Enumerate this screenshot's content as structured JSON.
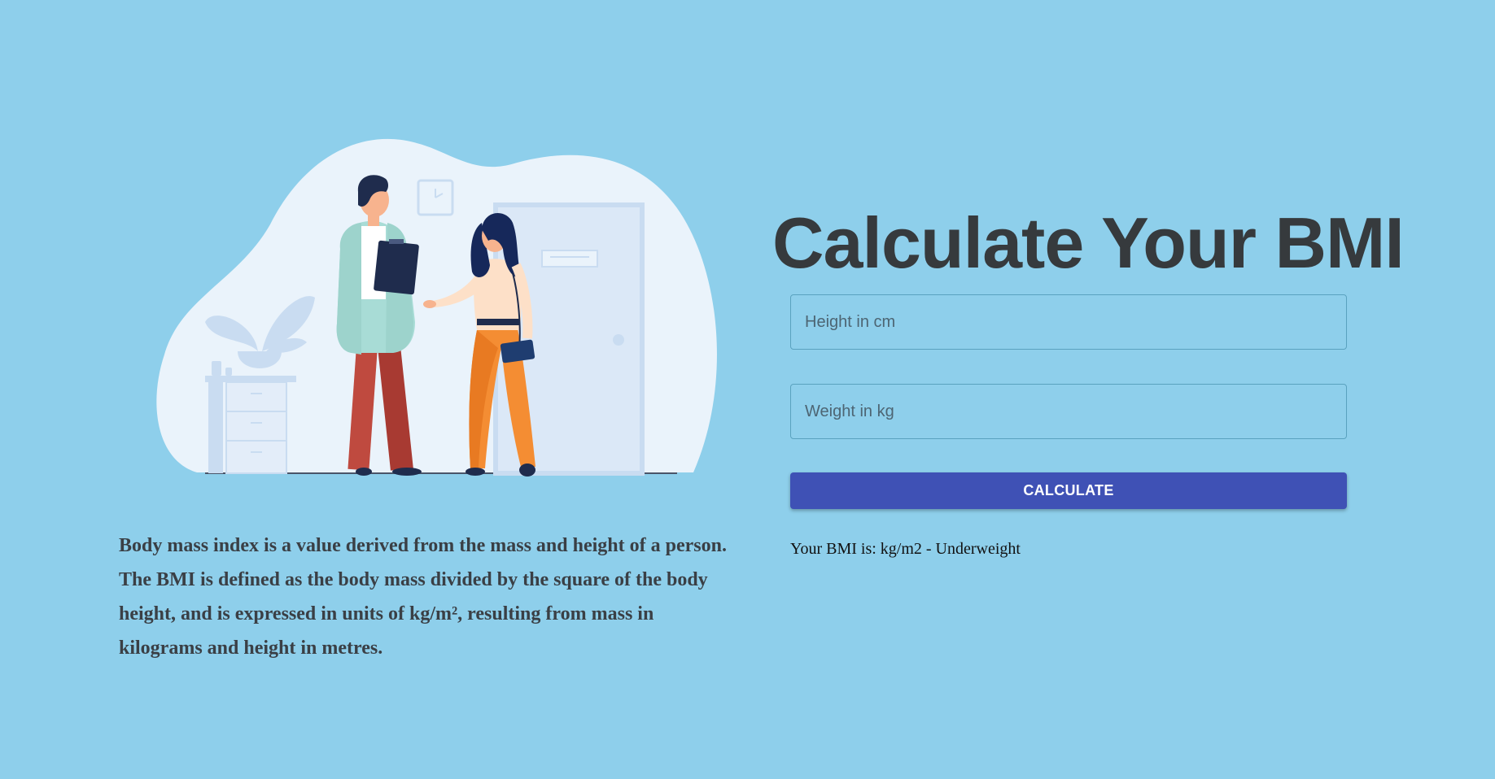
{
  "illustration": {
    "description_icon": "doctor-patient-illustration"
  },
  "info": {
    "text": "Body mass index is a value derived from the mass and height of a person. The BMI is defined as the body mass divided by the square of the body height, and is expressed in units of kg/m², resulting from mass in kilograms and height in metres."
  },
  "form": {
    "title": "Calculate Your BMI",
    "height_placeholder": "Height in cm",
    "height_value": "",
    "weight_placeholder": "Weight in kg",
    "weight_value": "",
    "button_label": "CALCULATE"
  },
  "result": {
    "text": "Your BMI is: kg/m2 - Underweight"
  },
  "colors": {
    "background": "#8ecfeb",
    "button": "#3f51b5",
    "title": "#363a3d"
  }
}
